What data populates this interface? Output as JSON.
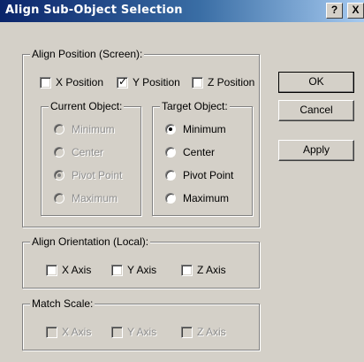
{
  "window": {
    "title": "Align Sub-Object Selection",
    "help_label": "?",
    "close_label": "X"
  },
  "align_position": {
    "label": "Align Position (Screen):",
    "x": {
      "label": "X Position",
      "checked": false
    },
    "y": {
      "label": "Y Position",
      "checked": true
    },
    "z": {
      "label": "Z Position",
      "checked": false
    },
    "current_object": {
      "label": "Current Object:",
      "options": [
        "Minimum",
        "Center",
        "Pivot Point",
        "Maximum"
      ],
      "selected": "Pivot Point",
      "enabled": false
    },
    "target_object": {
      "label": "Target Object:",
      "options": [
        "Minimum",
        "Center",
        "Pivot Point",
        "Maximum"
      ],
      "selected": "Minimum",
      "enabled": true
    }
  },
  "align_orientation": {
    "label": "Align Orientation (Local):",
    "x": {
      "label": "X Axis",
      "checked": false
    },
    "y": {
      "label": "Y Axis",
      "checked": false
    },
    "z": {
      "label": "Z Axis",
      "checked": false
    }
  },
  "match_scale": {
    "label": "Match Scale:",
    "x": {
      "label": "X Axis",
      "checked": false
    },
    "y": {
      "label": "Y Axis",
      "checked": false
    },
    "z": {
      "label": "Z Axis",
      "checked": false
    },
    "enabled": false
  },
  "buttons": {
    "ok": "OK",
    "cancel": "Cancel",
    "apply": "Apply"
  }
}
